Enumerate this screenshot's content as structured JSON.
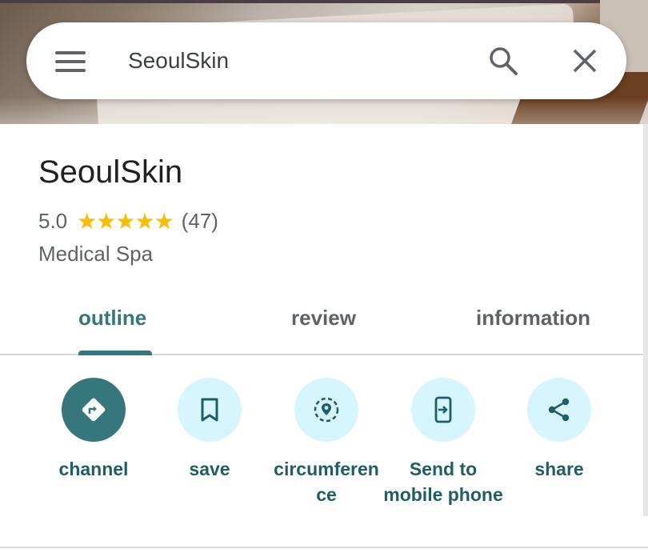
{
  "search": {
    "query": "SeoulSkin"
  },
  "place": {
    "name": "SeoulSkin",
    "rating": "5.0",
    "stars": "★★★★★",
    "star_count": 5,
    "review_count": "(47)",
    "category": "Medical Spa"
  },
  "tabs": [
    {
      "label": "outline",
      "active": true
    },
    {
      "label": "review",
      "active": false
    },
    {
      "label": "information",
      "active": false
    }
  ],
  "actions": [
    {
      "label": "channel",
      "icon": "directions-icon"
    },
    {
      "label": "save",
      "icon": "bookmark-icon"
    },
    {
      "label": "circumferen ce",
      "icon": "nearby-icon"
    },
    {
      "label": "Send to mobile phone",
      "icon": "send-to-phone-icon"
    },
    {
      "label": "share",
      "icon": "share-icon"
    }
  ],
  "colors": {
    "accent": "#36767d",
    "action_bg": "#d7f5fc",
    "star": "#fbbc04",
    "text_primary": "#202124",
    "text_secondary": "#5f6368"
  }
}
